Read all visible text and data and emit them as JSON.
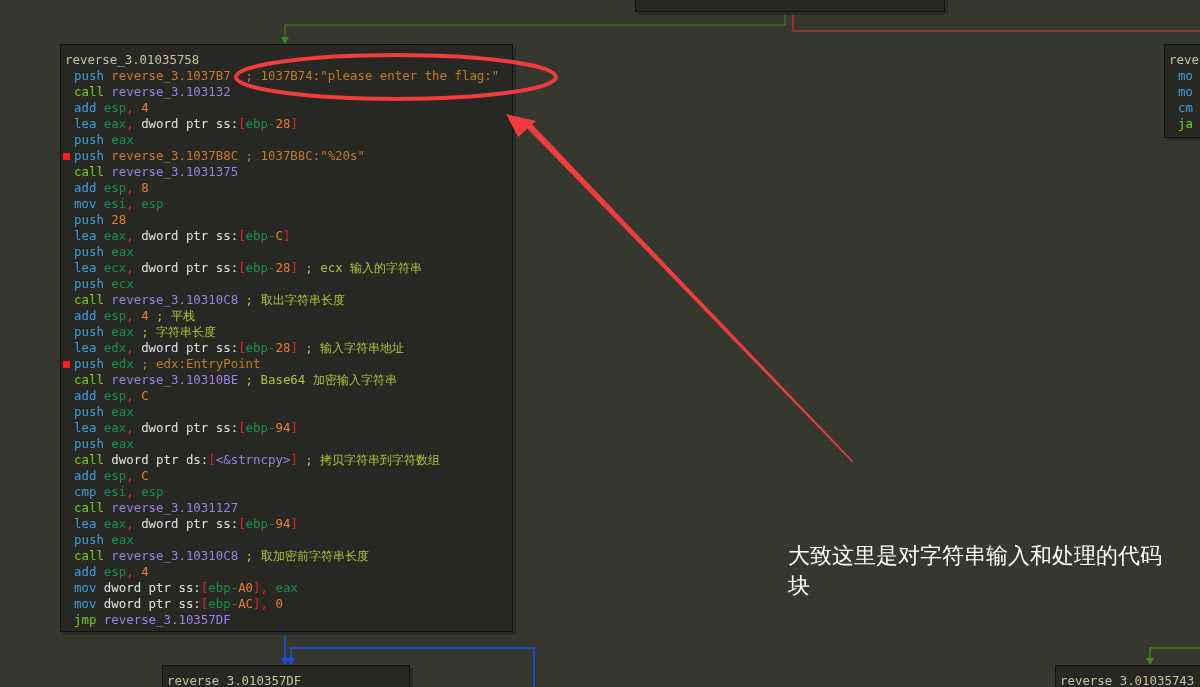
{
  "blocks": [
    {
      "title": "reverse_3.01035758",
      "lines": [
        {
          "breakpoint": false,
          "tokens": [
            {
              "kind": "m",
              "text": "push "
            },
            {
              "kind": "d",
              "text": "reverse_3.1037B7"
            },
            {
              "kind": "q",
              "text": "  ; 1037B74:\"please enter the flag:\""
            }
          ]
        },
        {
          "breakpoint": false,
          "tokens": [
            {
              "kind": "b",
              "text": "call "
            },
            {
              "kind": "s",
              "text": "reverse_3.103132"
            }
          ]
        },
        {
          "breakpoint": false,
          "tokens": [
            {
              "kind": "m",
              "text": "add "
            },
            {
              "kind": "r",
              "text": "esp"
            },
            {
              "kind": "p",
              "text": ", "
            },
            {
              "kind": "i",
              "text": "4"
            }
          ]
        },
        {
          "breakpoint": false,
          "tokens": [
            {
              "kind": "m",
              "text": "lea "
            },
            {
              "kind": "r",
              "text": "eax"
            },
            {
              "kind": "p",
              "text": ", "
            },
            {
              "kind": "t",
              "text": "dword ptr ss:"
            },
            {
              "kind": "p",
              "text": "["
            },
            {
              "kind": "r",
              "text": "ebp-"
            },
            {
              "kind": "i",
              "text": "28"
            },
            {
              "kind": "p",
              "text": "]"
            }
          ]
        },
        {
          "breakpoint": false,
          "tokens": [
            {
              "kind": "m",
              "text": "push "
            },
            {
              "kind": "r",
              "text": "eax"
            }
          ]
        },
        {
          "breakpoint": true,
          "tokens": [
            {
              "kind": "m",
              "text": "push "
            },
            {
              "kind": "d",
              "text": "reverse_3.1037B8C"
            },
            {
              "kind": "q",
              "text": " ; 1037B8C:\"%20s\""
            }
          ]
        },
        {
          "breakpoint": false,
          "tokens": [
            {
              "kind": "b",
              "text": "call "
            },
            {
              "kind": "s",
              "text": "reverse_3.1031375"
            }
          ]
        },
        {
          "breakpoint": false,
          "tokens": [
            {
              "kind": "m",
              "text": "add "
            },
            {
              "kind": "r",
              "text": "esp"
            },
            {
              "kind": "p",
              "text": ", "
            },
            {
              "kind": "i",
              "text": "8"
            }
          ]
        },
        {
          "breakpoint": false,
          "tokens": [
            {
              "kind": "m",
              "text": "mov "
            },
            {
              "kind": "r",
              "text": "esi"
            },
            {
              "kind": "p",
              "text": ", "
            },
            {
              "kind": "r",
              "text": "esp"
            }
          ]
        },
        {
          "breakpoint": false,
          "tokens": [
            {
              "kind": "m",
              "text": "push "
            },
            {
              "kind": "i",
              "text": "28"
            }
          ]
        },
        {
          "breakpoint": false,
          "tokens": [
            {
              "kind": "m",
              "text": "lea "
            },
            {
              "kind": "r",
              "text": "eax"
            },
            {
              "kind": "p",
              "text": ", "
            },
            {
              "kind": "t",
              "text": "dword ptr ss:"
            },
            {
              "kind": "p",
              "text": "["
            },
            {
              "kind": "r",
              "text": "ebp-"
            },
            {
              "kind": "i",
              "text": "C"
            },
            {
              "kind": "p",
              "text": "]"
            }
          ]
        },
        {
          "breakpoint": false,
          "tokens": [
            {
              "kind": "m",
              "text": "push "
            },
            {
              "kind": "r",
              "text": "eax"
            }
          ]
        },
        {
          "breakpoint": false,
          "tokens": [
            {
              "kind": "m",
              "text": "lea "
            },
            {
              "kind": "r",
              "text": "ecx"
            },
            {
              "kind": "p",
              "text": ", "
            },
            {
              "kind": "t",
              "text": "dword ptr ss:"
            },
            {
              "kind": "p",
              "text": "["
            },
            {
              "kind": "r",
              "text": "ebp-"
            },
            {
              "kind": "i",
              "text": "28"
            },
            {
              "kind": "p",
              "text": "]"
            },
            {
              "kind": "c",
              "text": " ; ecx 输入的字符串"
            }
          ]
        },
        {
          "breakpoint": false,
          "tokens": [
            {
              "kind": "m",
              "text": "push "
            },
            {
              "kind": "r",
              "text": "ecx"
            }
          ]
        },
        {
          "breakpoint": false,
          "tokens": [
            {
              "kind": "b",
              "text": "call "
            },
            {
              "kind": "s",
              "text": "reverse_3.10310C8"
            },
            {
              "kind": "c",
              "text": " ; 取出字符串长度"
            }
          ]
        },
        {
          "breakpoint": false,
          "tokens": [
            {
              "kind": "m",
              "text": "add "
            },
            {
              "kind": "r",
              "text": "esp"
            },
            {
              "kind": "p",
              "text": ", "
            },
            {
              "kind": "i",
              "text": "4"
            },
            {
              "kind": "c",
              "text": " ; 平栈"
            }
          ]
        },
        {
          "breakpoint": false,
          "tokens": [
            {
              "kind": "m",
              "text": "push "
            },
            {
              "kind": "r",
              "text": "eax"
            },
            {
              "kind": "c",
              "text": " ; 字符串长度"
            }
          ]
        },
        {
          "breakpoint": false,
          "tokens": [
            {
              "kind": "m",
              "text": "lea "
            },
            {
              "kind": "r",
              "text": "edx"
            },
            {
              "kind": "p",
              "text": ", "
            },
            {
              "kind": "t",
              "text": "dword ptr ss:"
            },
            {
              "kind": "p",
              "text": "["
            },
            {
              "kind": "r",
              "text": "ebp-"
            },
            {
              "kind": "i",
              "text": "28"
            },
            {
              "kind": "p",
              "text": "]"
            },
            {
              "kind": "c",
              "text": " ; 输入字符串地址"
            }
          ]
        },
        {
          "breakpoint": true,
          "tokens": [
            {
              "kind": "m",
              "text": "push "
            },
            {
              "kind": "r",
              "text": "edx"
            },
            {
              "kind": "q",
              "text": " ; edx:EntryPoint"
            }
          ]
        },
        {
          "breakpoint": false,
          "tokens": [
            {
              "kind": "b",
              "text": "call "
            },
            {
              "kind": "s",
              "text": "reverse_3.10310BE"
            },
            {
              "kind": "c",
              "text": " ; Base64 加密输入字符串"
            }
          ]
        },
        {
          "breakpoint": false,
          "tokens": [
            {
              "kind": "m",
              "text": "add "
            },
            {
              "kind": "r",
              "text": "esp"
            },
            {
              "kind": "p",
              "text": ", "
            },
            {
              "kind": "i",
              "text": "C"
            }
          ]
        },
        {
          "breakpoint": false,
          "tokens": [
            {
              "kind": "m",
              "text": "push "
            },
            {
              "kind": "r",
              "text": "eax"
            }
          ]
        },
        {
          "breakpoint": false,
          "tokens": [
            {
              "kind": "m",
              "text": "lea "
            },
            {
              "kind": "r",
              "text": "eax"
            },
            {
              "kind": "p",
              "text": ", "
            },
            {
              "kind": "t",
              "text": "dword ptr ss:"
            },
            {
              "kind": "p",
              "text": "["
            },
            {
              "kind": "r",
              "text": "ebp-"
            },
            {
              "kind": "i",
              "text": "94"
            },
            {
              "kind": "p",
              "text": "]"
            }
          ]
        },
        {
          "breakpoint": false,
          "tokens": [
            {
              "kind": "m",
              "text": "push "
            },
            {
              "kind": "r",
              "text": "eax"
            }
          ]
        },
        {
          "breakpoint": false,
          "tokens": [
            {
              "kind": "b",
              "text": "call "
            },
            {
              "kind": "t",
              "text": "dword ptr ds:"
            },
            {
              "kind": "p",
              "text": "["
            },
            {
              "kind": "s",
              "text": "<&strncpy>"
            },
            {
              "kind": "p",
              "text": "]"
            },
            {
              "kind": "c",
              "text": " ; 拷贝字符串到字符数组"
            }
          ]
        },
        {
          "breakpoint": false,
          "tokens": [
            {
              "kind": "m",
              "text": "add "
            },
            {
              "kind": "r",
              "text": "esp"
            },
            {
              "kind": "p",
              "text": ", "
            },
            {
              "kind": "i",
              "text": "C"
            }
          ]
        },
        {
          "breakpoint": false,
          "tokens": [
            {
              "kind": "m",
              "text": "cmp "
            },
            {
              "kind": "r",
              "text": "esi"
            },
            {
              "kind": "p",
              "text": ", "
            },
            {
              "kind": "r",
              "text": "esp"
            }
          ]
        },
        {
          "breakpoint": false,
          "tokens": [
            {
              "kind": "b",
              "text": "call "
            },
            {
              "kind": "s",
              "text": "reverse_3.1031127"
            }
          ]
        },
        {
          "breakpoint": false,
          "tokens": [
            {
              "kind": "m",
              "text": "lea "
            },
            {
              "kind": "r",
              "text": "eax"
            },
            {
              "kind": "p",
              "text": ", "
            },
            {
              "kind": "t",
              "text": "dword ptr ss:"
            },
            {
              "kind": "p",
              "text": "["
            },
            {
              "kind": "r",
              "text": "ebp-"
            },
            {
              "kind": "i",
              "text": "94"
            },
            {
              "kind": "p",
              "text": "]"
            }
          ]
        },
        {
          "breakpoint": false,
          "tokens": [
            {
              "kind": "m",
              "text": "push "
            },
            {
              "kind": "r",
              "text": "eax"
            }
          ]
        },
        {
          "breakpoint": false,
          "tokens": [
            {
              "kind": "b",
              "text": "call "
            },
            {
              "kind": "s",
              "text": "reverse_3.10310C8"
            },
            {
              "kind": "c",
              "text": " ; 取加密前字符串长度"
            }
          ]
        },
        {
          "breakpoint": false,
          "tokens": [
            {
              "kind": "m",
              "text": "add "
            },
            {
              "kind": "r",
              "text": "esp"
            },
            {
              "kind": "p",
              "text": ", "
            },
            {
              "kind": "i",
              "text": "4"
            }
          ]
        },
        {
          "breakpoint": false,
          "tokens": [
            {
              "kind": "m",
              "text": "mov "
            },
            {
              "kind": "t",
              "text": "dword ptr ss:"
            },
            {
              "kind": "p",
              "text": "["
            },
            {
              "kind": "r",
              "text": "ebp-"
            },
            {
              "kind": "i",
              "text": "A0"
            },
            {
              "kind": "p",
              "text": "], "
            },
            {
              "kind": "r",
              "text": "eax"
            }
          ]
        },
        {
          "breakpoint": false,
          "tokens": [
            {
              "kind": "m",
              "text": "mov "
            },
            {
              "kind": "t",
              "text": "dword ptr ss:"
            },
            {
              "kind": "p",
              "text": "["
            },
            {
              "kind": "r",
              "text": "ebp-"
            },
            {
              "kind": "i",
              "text": "AC"
            },
            {
              "kind": "p",
              "text": "], "
            },
            {
              "kind": "i",
              "text": "0"
            }
          ]
        },
        {
          "breakpoint": false,
          "tokens": [
            {
              "kind": "b",
              "text": "jmp "
            },
            {
              "kind": "s",
              "text": "reverse_3.10357DF"
            }
          ]
        }
      ]
    },
    {
      "title": "reve",
      "lines": [
        {
          "breakpoint": false,
          "tokens": [
            {
              "kind": "m",
              "text": "mo"
            }
          ]
        },
        {
          "breakpoint": false,
          "tokens": [
            {
              "kind": "m",
              "text": "mo"
            }
          ]
        },
        {
          "breakpoint": false,
          "tokens": [
            {
              "kind": "m",
              "text": "cm"
            }
          ]
        },
        {
          "breakpoint": false,
          "tokens": [
            {
              "kind": "b",
              "text": "ja"
            }
          ]
        }
      ]
    },
    {
      "title": "reverse 3.010357DF"
    },
    {
      "title": "reverse 3.01035743"
    }
  ],
  "annotation": {
    "note": "大致这里是对字符串输入和处理的代码块"
  }
}
